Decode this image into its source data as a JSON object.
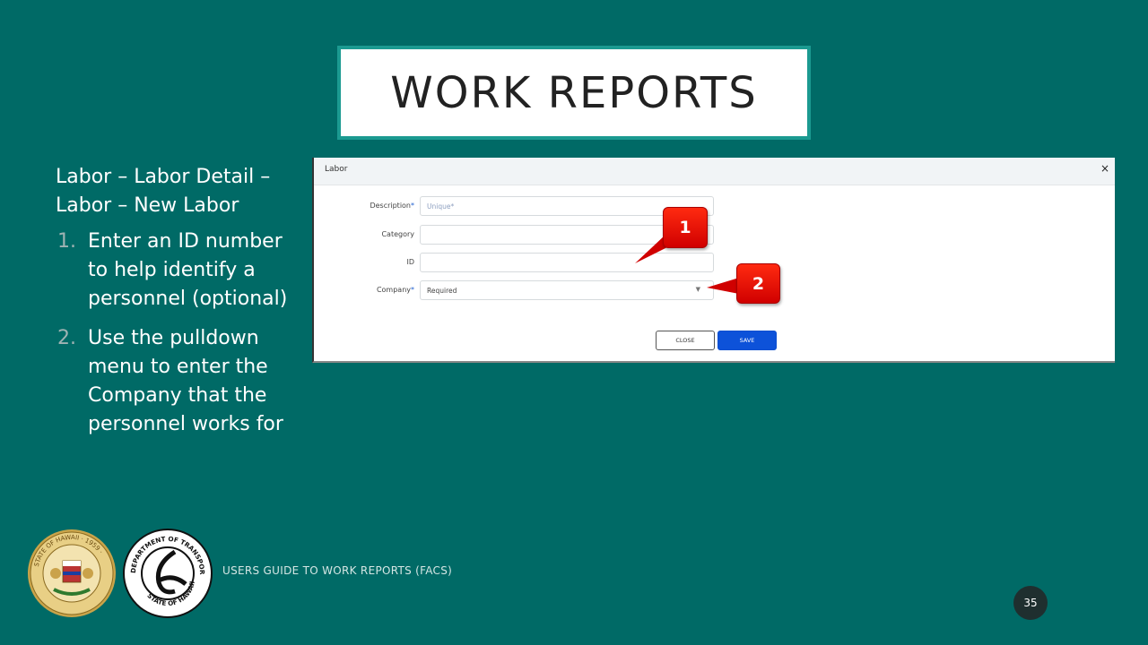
{
  "slide": {
    "title": "WORK REPORTS",
    "lead": "Labor – Labor Detail – Labor – New Labor",
    "steps": [
      {
        "num": "1.",
        "text": "Enter an ID number to help identify a personnel (optional)"
      },
      {
        "num": "2.",
        "text": "Use the pulldown menu to enter the Company that the personnel works for"
      }
    ],
    "footer": "USERS GUIDE TO WORK REPORTS  (FACS)",
    "page_number": "35"
  },
  "dialog": {
    "title": "Labor",
    "close_icon": "×",
    "fields": [
      {
        "label": "Description",
        "required": "*",
        "placeholder": "Unique*",
        "value": ""
      },
      {
        "label": "Category",
        "required": "",
        "placeholder": "",
        "value": ""
      },
      {
        "label": "ID",
        "required": "",
        "placeholder": "",
        "value": ""
      },
      {
        "label": "Company",
        "required": "*",
        "placeholder": "",
        "value": "Required"
      }
    ],
    "close_label": "CLOSE",
    "save_label": "SAVE"
  },
  "callouts": [
    {
      "label": "1"
    },
    {
      "label": "2"
    }
  ],
  "seals": {
    "hawaii_text": "STATE OF HAWAII · 1959 ·",
    "dot_text_top": "DEPARTMENT OF TRANSPORTATION",
    "dot_text_bottom": "STATE OF HAWAII"
  },
  "colors": {
    "background": "#006A66",
    "title_border": "#1b9a91",
    "save_button": "#0d52d9",
    "callout": "#e00000"
  }
}
